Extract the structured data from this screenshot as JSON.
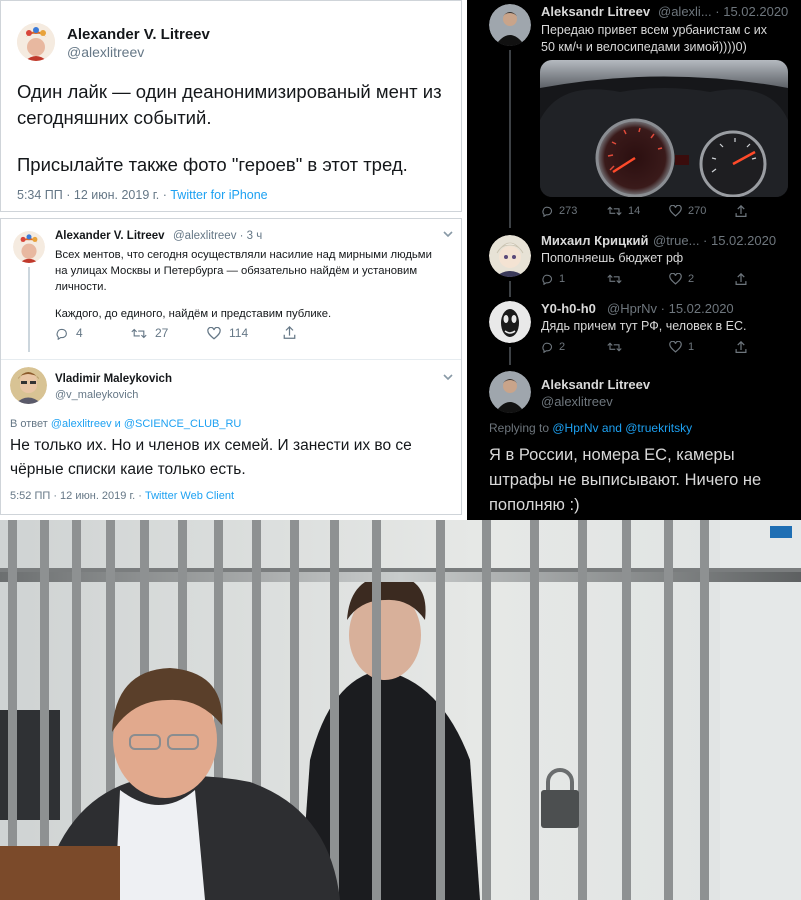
{
  "tweet1": {
    "name": "Alexander V. Litreev",
    "handle": "@alexlitreev",
    "text_line1": "Один лайк — один деанонимизированый мент из",
    "text_line2": "сегодняшних событий.",
    "text_line3": "Присылайте также фото \"героев\" в этот тред.",
    "time": "5:34 ПП · 12 июн. 2019 г. · ",
    "source": "Twitter for iPhone"
  },
  "tweet2": {
    "name": "Alexander V. Litreev",
    "handle": "@alexlitreev · 3 ч",
    "text_line1": "Всех ментов, что сегодня осуществляли насилие над мирными людьми",
    "text_line2": "на улицах Москвы и Петербурга — обязательно найдём и установим",
    "text_line3": "личности.",
    "text_line4": "Каждого, до единого, найдём и представим публике.",
    "replies": "4",
    "retweets": "27",
    "likes": "114"
  },
  "tweet3": {
    "name": "Vladimir Maleykovich",
    "handle": "@v_maleykovich",
    "reply_prefix": "В ответ ",
    "reply_to": "@alexlitreev и @SCIENCE_CLUB_RU",
    "text_line1": "Не только их. Но и членов их семей. И занести их во се",
    "text_line2": "чёрные списки каие только есть.",
    "time": "5:52 ПП · 12 июн. 2019 г. · ",
    "source": "Twitter Web Client"
  },
  "dark": {
    "t1": {
      "name": "Aleksandr Litreev",
      "handle": "@alexli... · 15.02.2020",
      "text_line1": "Передаю привет всем урбанистам с их",
      "text_line2": "50 км/ч и велосипедами зимой))))0)",
      "replies": "273",
      "retweets": "14",
      "likes": "270"
    },
    "t2": {
      "name": "Михаил Крицкий",
      "handle": "@true... · 15.02.2020",
      "text": "Пополняешь бюджет рф",
      "replies": "1",
      "retweets": "",
      "likes": "2"
    },
    "t3": {
      "name": "Y0-h0-h0",
      "handle": "@HprNv · 15.02.2020",
      "text": "Дядь причем тут РФ, человек в ЕС.",
      "replies": "2",
      "retweets": "",
      "likes": "1"
    },
    "t4": {
      "name": "Aleksandr Litreev",
      "handle": "@alexlitreev",
      "replying_prefix": "Replying to ",
      "replying_to": "@HprNv and @truekritsky",
      "text_line1": "Я в России, номера ЕС, камеры",
      "text_line2": "штрафы не выписывают. Ничего не",
      "text_line3": "пополняю :)"
    },
    "colors": {
      "link": "#1da1f2",
      "background": "#000000"
    }
  }
}
